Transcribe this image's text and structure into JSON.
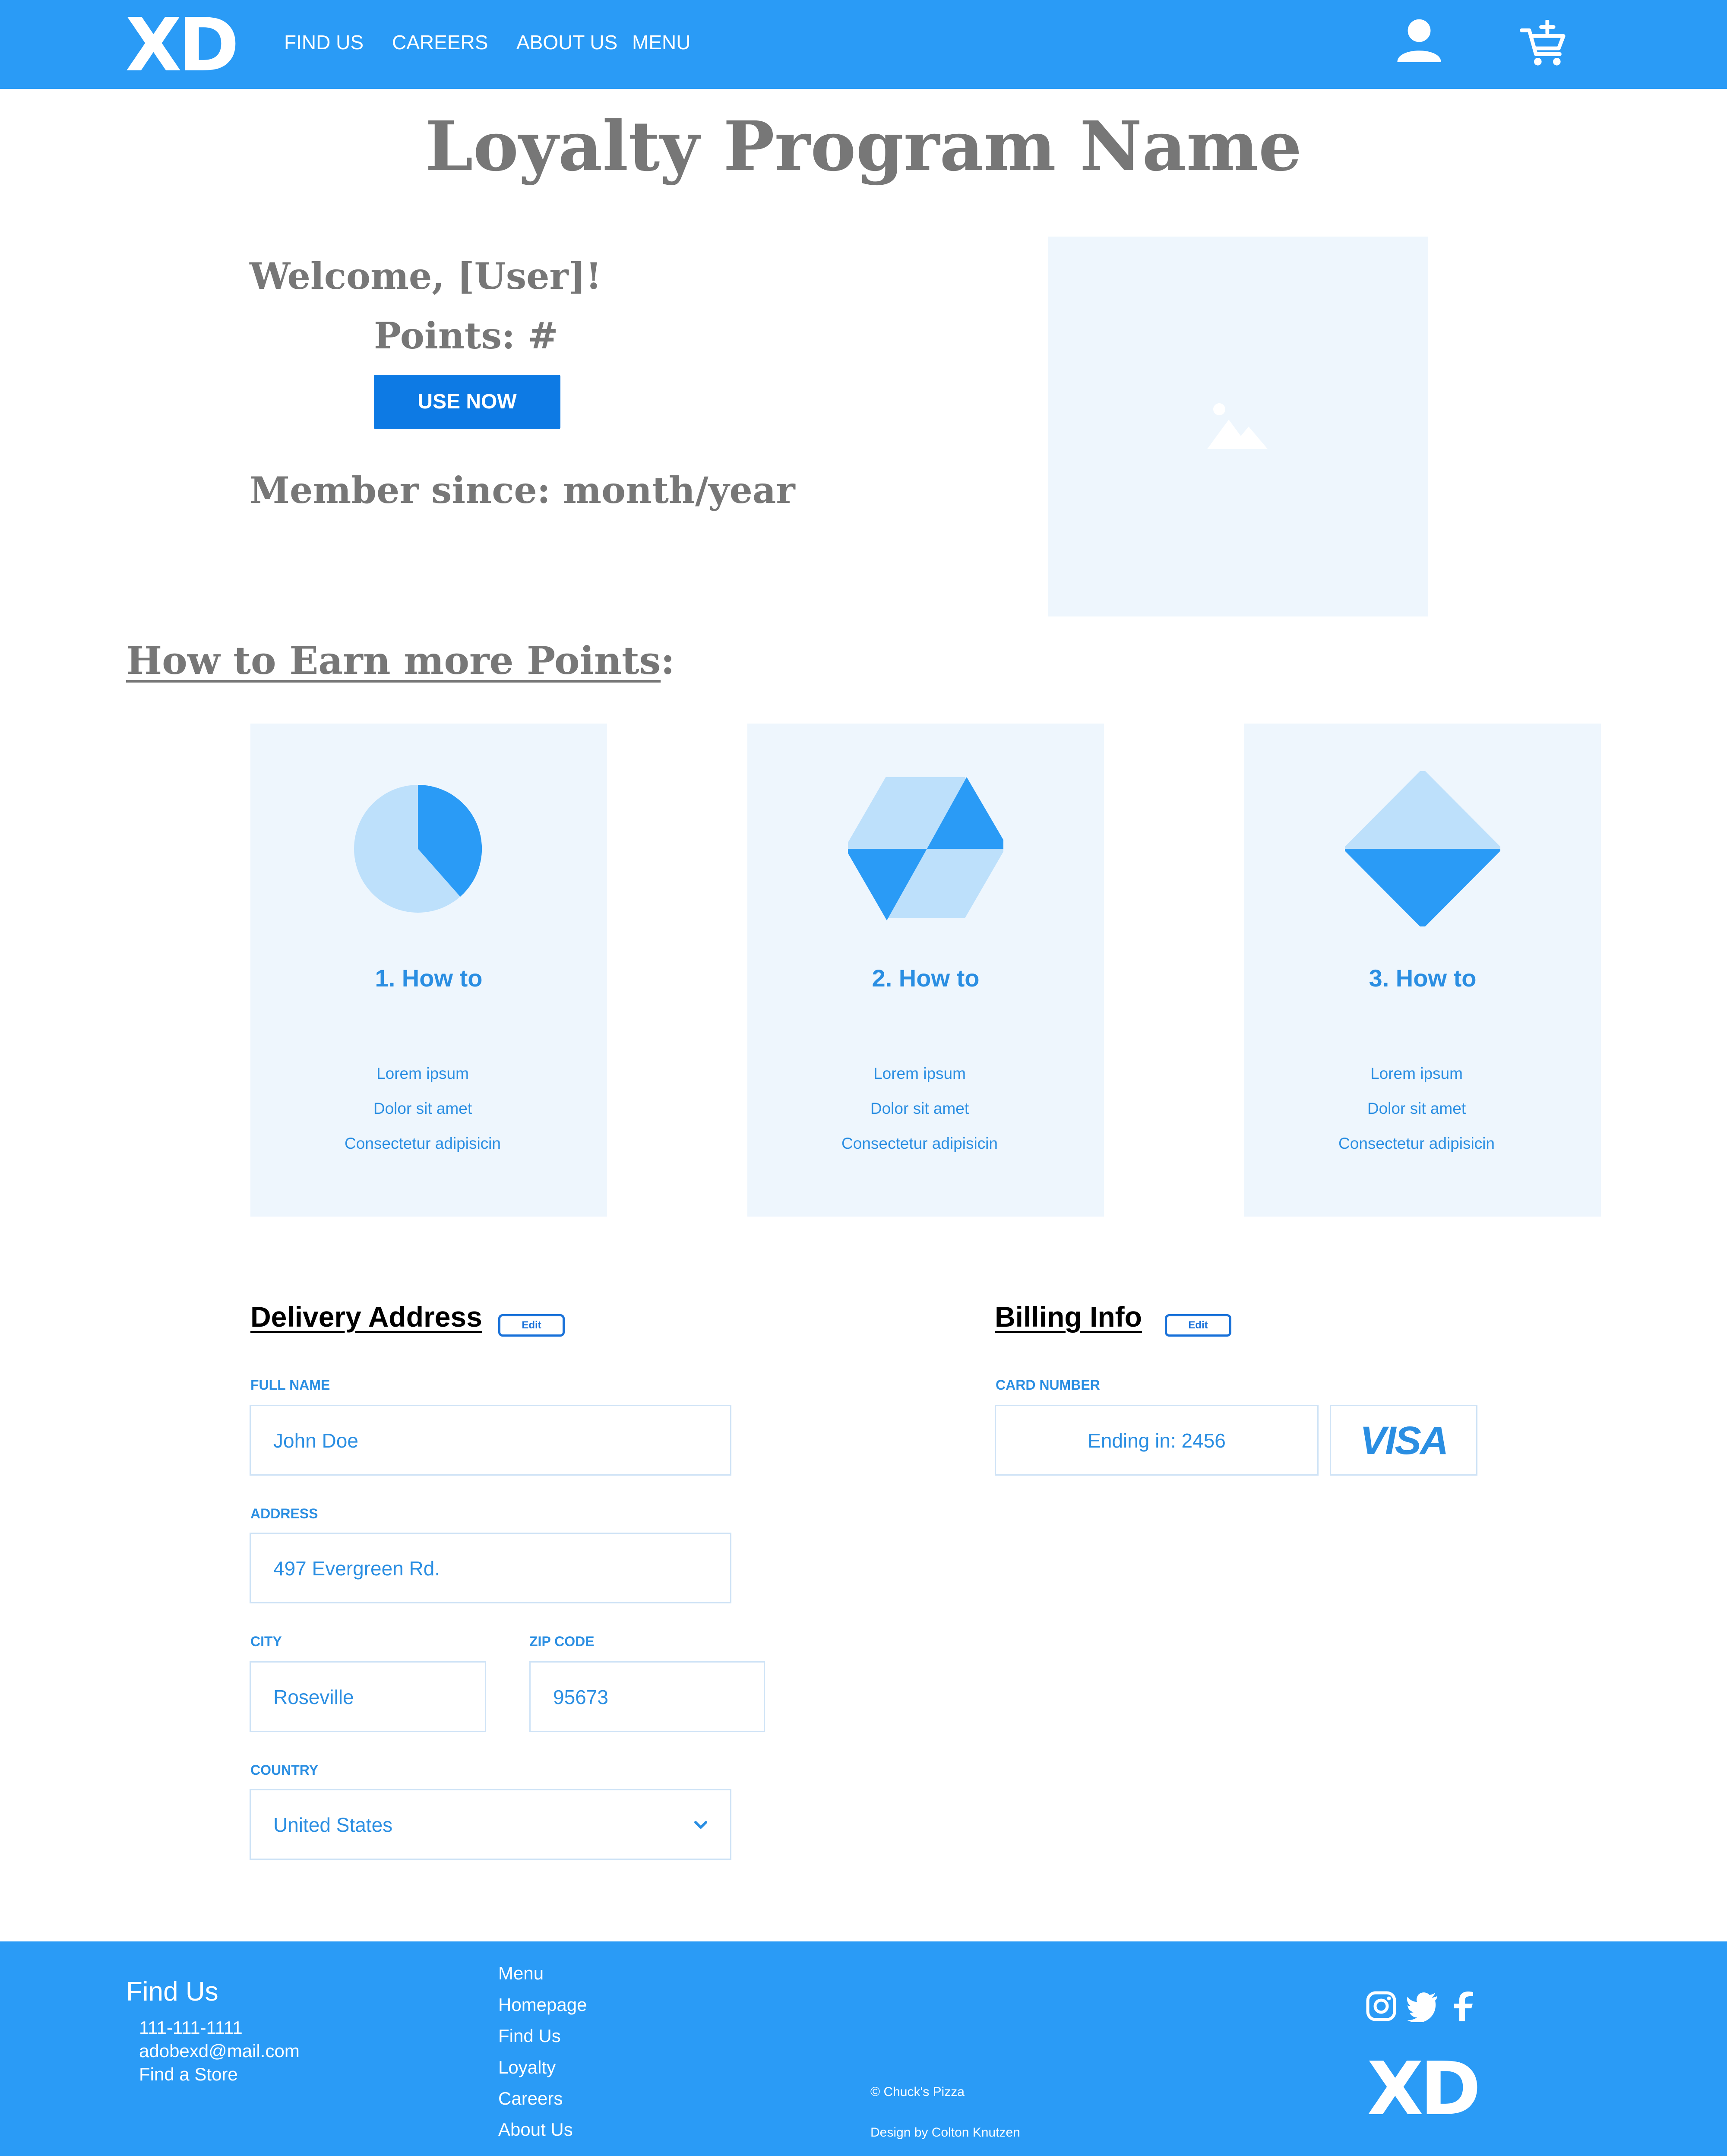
{
  "header": {
    "logo": "XD",
    "nav": [
      {
        "label": "FIND US"
      },
      {
        "label": "CAREERS"
      },
      {
        "label": "ABOUT US"
      },
      {
        "label": "MENU"
      }
    ],
    "icons": [
      "user-icon",
      "cart-add-icon"
    ],
    "background": "#2a9bf6"
  },
  "page_title": "Loyalty Program Name",
  "account": {
    "welcome": "Welcome, [User]!",
    "points": "Points: #",
    "use_now": "USE NOW",
    "member_since": "Member since: month/year"
  },
  "earn": {
    "heading_underlined": "How to Earn more Points",
    "heading_suffix": ":",
    "cards": [
      {
        "icon": "pie-chart-icon",
        "title": "1. How to",
        "lines": [
          "Lorem ipsum",
          "Dolor sit amet",
          "Consectetur adipisicin"
        ]
      },
      {
        "icon": "hexagon-icon",
        "title": "2. How to",
        "lines": [
          "Lorem ipsum",
          "Dolor sit amet",
          "Consectetur adipisicin"
        ]
      },
      {
        "icon": "diamond-icon",
        "title": "3. How to",
        "lines": [
          "Lorem ipsum",
          "Dolor sit amet",
          "Consectetur adipisicin"
        ]
      }
    ]
  },
  "delivery": {
    "title": "Delivery Address",
    "edit": "Edit",
    "full_name_label": "FULL NAME",
    "full_name": "John Doe",
    "address_label": "ADDRESS",
    "address": "497 Evergreen Rd.",
    "city_label": "CITY",
    "city": "Roseville",
    "zip_label": "ZIP CODE",
    "zip": "95673",
    "country_label": "COUNTRY",
    "country": "United States"
  },
  "billing": {
    "title": "Billing Info",
    "edit": "Edit",
    "card_label": "CARD NUMBER",
    "card_ending": "Ending in:  2456",
    "card_brand": "VISA"
  },
  "footer": {
    "find_us_title": "Find Us",
    "contact": [
      "111-111-1111",
      "adobexd@mail.com",
      "Find a Store"
    ],
    "menu": [
      "Menu",
      "Homepage",
      "Find Us",
      "Loyalty",
      "Careers",
      "About Us"
    ],
    "copyright": "© Chuck's Pizza",
    "credit": "Design by Colton Knutzen",
    "social": [
      "instagram-icon",
      "twitter-icon",
      "facebook-icon"
    ],
    "logo": "XD"
  },
  "colors": {
    "primary": "#2a9bf6",
    "button": "#0d7ae4",
    "card_bg": "#eef6fd",
    "text_blue": "#2a8ee2",
    "heading_gray": "#777777"
  }
}
